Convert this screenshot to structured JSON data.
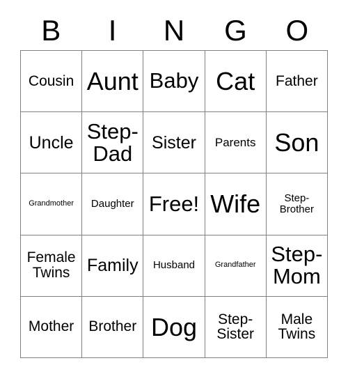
{
  "header": {
    "letters": [
      "B",
      "I",
      "N",
      "G",
      "O"
    ]
  },
  "grid": {
    "rows": 5,
    "columns": 5,
    "border_color": "#808080",
    "background_color": "#ffffff",
    "text_color": "#000000",
    "cells": [
      {
        "text": "Cousin",
        "size": "sm"
      },
      {
        "text": "Aunt",
        "size": "xl"
      },
      {
        "text": "Baby",
        "size": "lg"
      },
      {
        "text": "Cat",
        "size": "xl"
      },
      {
        "text": "Father",
        "size": "sm"
      },
      {
        "text": "Uncle",
        "size": "md"
      },
      {
        "text": "Step-\nDad",
        "size": "lg"
      },
      {
        "text": "Sister",
        "size": "md"
      },
      {
        "text": "Parents",
        "size": "xs"
      },
      {
        "text": "Son",
        "size": "xl"
      },
      {
        "text": "Grandmother",
        "size": "min"
      },
      {
        "text": "Daughter",
        "size": "xxs"
      },
      {
        "text": "Free!",
        "size": "lg"
      },
      {
        "text": "Wife",
        "size": "xl"
      },
      {
        "text": "Step-\nBrother",
        "size": "xxs"
      },
      {
        "text": "Female\nTwins",
        "size": "sm"
      },
      {
        "text": "Family",
        "size": "md"
      },
      {
        "text": "Husband",
        "size": "xxs"
      },
      {
        "text": "Grandfather",
        "size": "min"
      },
      {
        "text": "Step-\nMom",
        "size": "lg"
      },
      {
        "text": "Mother",
        "size": "sm"
      },
      {
        "text": "Brother",
        "size": "sm"
      },
      {
        "text": "Dog",
        "size": "xl"
      },
      {
        "text": "Step-\nSister",
        "size": "sm"
      },
      {
        "text": "Male\nTwins",
        "size": "sm"
      }
    ]
  }
}
